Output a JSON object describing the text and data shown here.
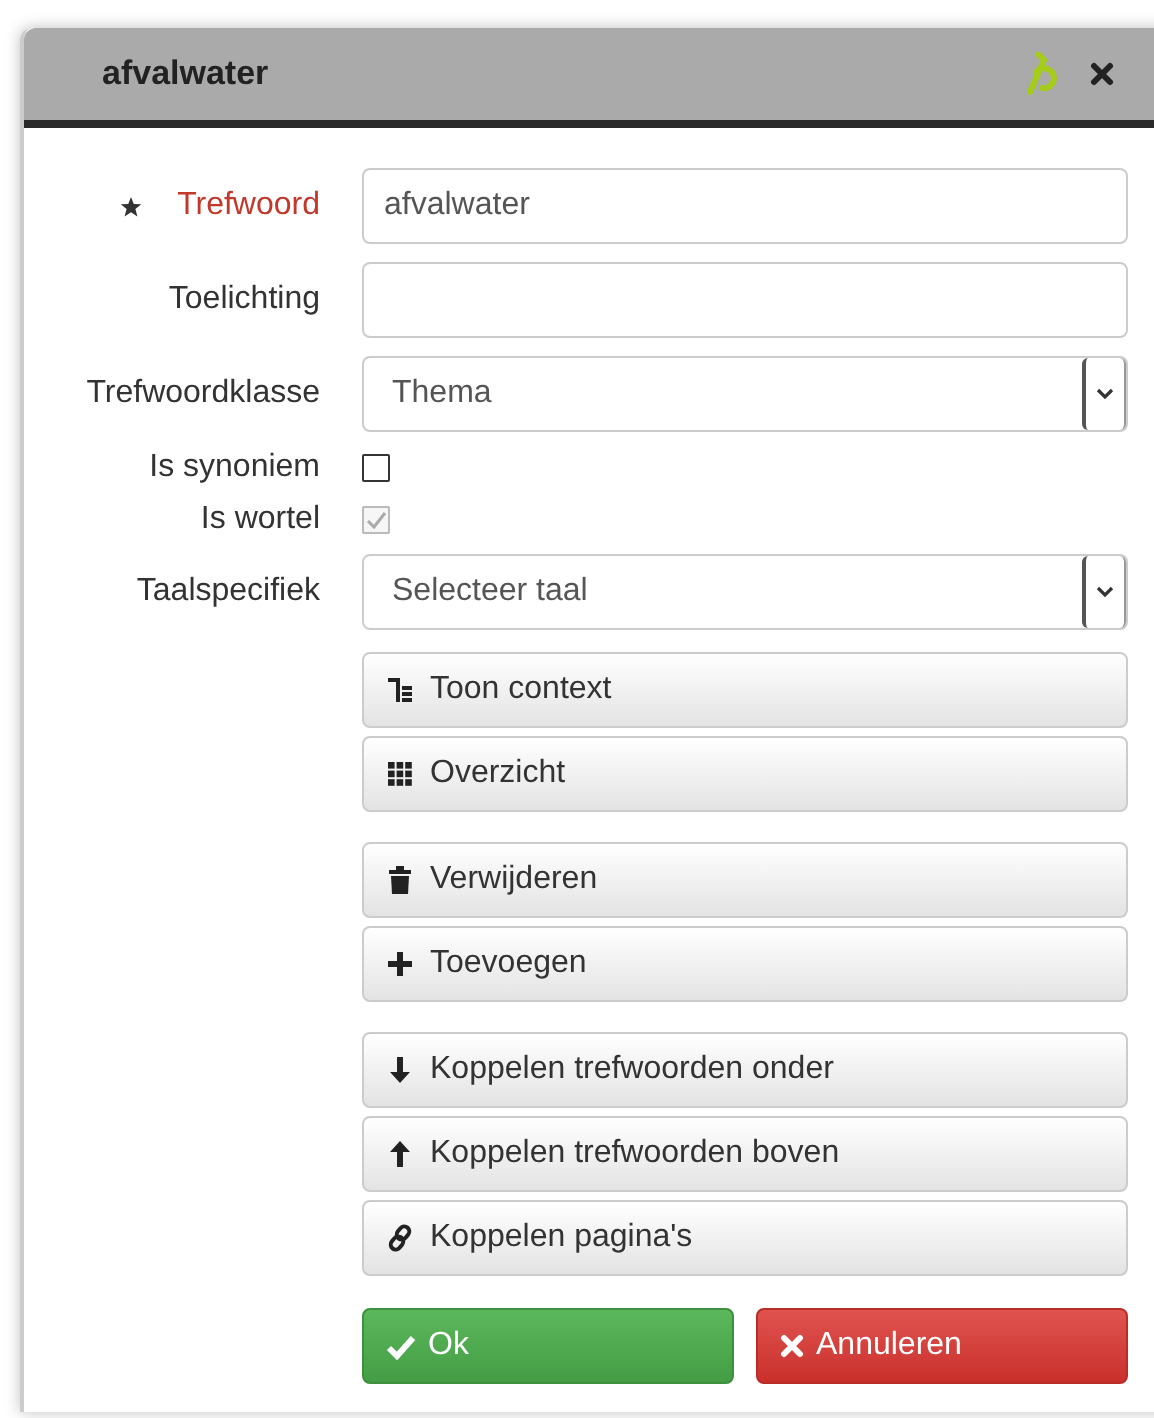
{
  "dialog": {
    "title": "afvalwater"
  },
  "fields": [
    {
      "kind": "text",
      "label": "Trefwoord",
      "required": true,
      "value": "afvalwater"
    },
    {
      "kind": "text",
      "label": "Toelichting",
      "required": false
    },
    {
      "kind": "select",
      "label": "Trefwoordklasse",
      "required": false,
      "value": "Thema"
    },
    {
      "kind": "checkbox",
      "label": "Is synoniem",
      "required": false,
      "checked": false,
      "disabled": false
    },
    {
      "kind": "checkbox",
      "label": "Is wortel",
      "required": false,
      "checked": true,
      "disabled": true
    },
    {
      "kind": "select",
      "label": "Taalspecifiek",
      "required": false,
      "value": "Selecteer taal"
    }
  ],
  "button_groups": [
    [
      {
        "kind": "context",
        "label": "Toon context"
      },
      {
        "kind": "grid",
        "label": "Overzicht"
      }
    ],
    [
      {
        "kind": "trash",
        "label": "Verwijderen"
      },
      {
        "kind": "plus",
        "label": "Toevoegen"
      }
    ],
    [
      {
        "kind": "arrow-down",
        "label": "Koppelen trefwoorden onder"
      },
      {
        "kind": "arrow-up",
        "label": "Koppelen trefwoorden boven"
      },
      {
        "kind": "link",
        "label": "Koppelen pagina's"
      }
    ]
  ],
  "footer_buttons": [
    {
      "kind": "ok",
      "label": "Ok"
    },
    {
      "kind": "cancel",
      "label": "Annuleren"
    }
  ]
}
